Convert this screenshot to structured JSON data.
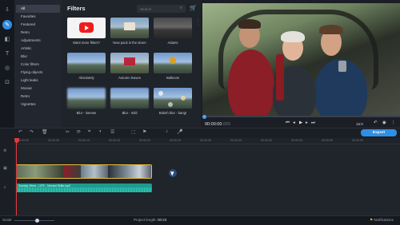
{
  "rail": {
    "icons": [
      "import-icon",
      "filters-icon",
      "transitions-icon",
      "titles-icon",
      "stickers-icon",
      "more-tools-icon"
    ]
  },
  "categories": [
    "All",
    "Favorites",
    "Featured",
    "Retro",
    "Adjustments",
    "Artistic",
    "Blur",
    "Color filters",
    "Flying objects",
    "Light leaks",
    "Mosaic",
    "Retro",
    "Vignettes"
  ],
  "filters": {
    "title": "Filters",
    "search_placeholder": "Search",
    "tiles": [
      {
        "label": "Want more filters?"
      },
      {
        "label": "New pack in the store!"
      },
      {
        "label": "Adams"
      },
      {
        "label": "Absolutely"
      },
      {
        "label": "Autumn leaves"
      },
      {
        "label": "Balloons"
      },
      {
        "label": "Blur - intense"
      },
      {
        "label": "Blur - mild"
      },
      {
        "label": "Bokeh blur - bang!"
      }
    ]
  },
  "player": {
    "timecode": "00:00:00",
    "timecode_ms": ".000",
    "aspect": "16:9"
  },
  "toolbar": {
    "export_label": "Export"
  },
  "timeline": {
    "ruler_ticks": [
      "00:00:00",
      "00:00:05",
      "00:00:10",
      "00:00:15",
      "00:00:20",
      "00:00:25",
      "00:00:30",
      "00:00:35",
      "00:00:40",
      "00:00:45",
      "00:00:50",
      "00:00:55"
    ],
    "audio_clip_label": "Sunday Vibes - LIFE - Nomad Skills.mp3"
  },
  "status": {
    "scale_label": "Scale:",
    "project_length_label": "Project length:",
    "project_length_value": "00:23",
    "notifications_label": "Notifications"
  }
}
